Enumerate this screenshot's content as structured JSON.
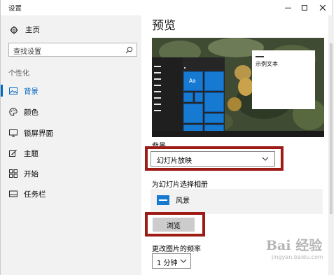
{
  "window": {
    "title": "设置"
  },
  "sidebar": {
    "home_label": "主页",
    "search_placeholder": "查找设置",
    "section_label": "个性化",
    "items": [
      {
        "label": "背景",
        "icon": "picture-icon",
        "active": true
      },
      {
        "label": "颜色",
        "icon": "palette-icon",
        "active": false
      },
      {
        "label": "锁屏界面",
        "icon": "monitor-icon",
        "active": false
      },
      {
        "label": "主题",
        "icon": "theme-icon",
        "active": false
      },
      {
        "label": "开始",
        "icon": "start-grid-icon",
        "active": false
      },
      {
        "label": "任务栏",
        "icon": "taskbar-icon",
        "active": false
      }
    ]
  },
  "main": {
    "title": "预览",
    "preview": {
      "tile_label": "Aa",
      "sample_text": "示例文本"
    },
    "background_label": "背景",
    "background_value": "幻灯片放映",
    "album_label": "为幻灯片选择相册",
    "album_name": "风景",
    "browse_label": "浏览",
    "frequency_label": "更改图片的频率",
    "frequency_value": "1 分钟"
  },
  "watermark": {
    "text": "Bai 经验",
    "subtext": "jingyan.baidu.com"
  },
  "colors": {
    "accent": "#0067c0",
    "tile_blue": "#1679d2",
    "highlight_red": "#9e1c16"
  }
}
